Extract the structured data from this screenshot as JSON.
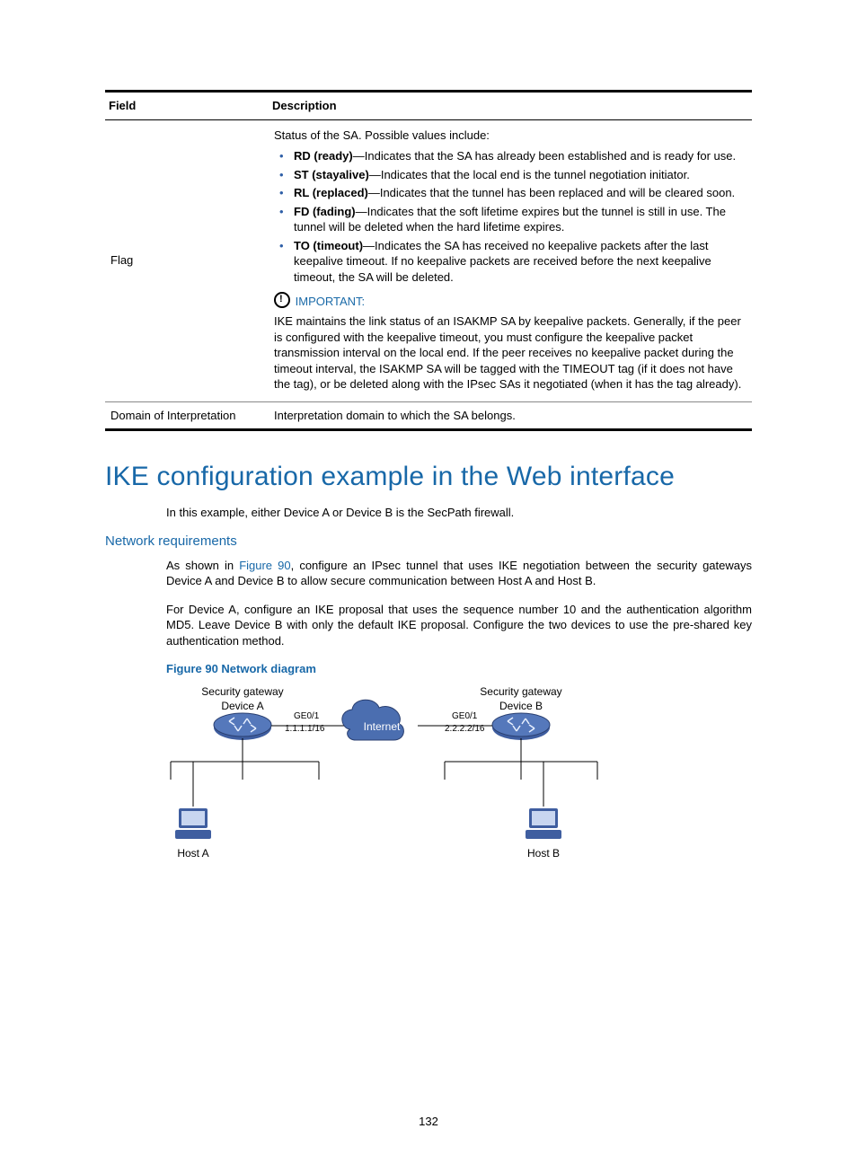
{
  "table": {
    "header_field": "Field",
    "header_desc": "Description",
    "rows": [
      {
        "field": "Flag",
        "intro": "Status of the SA. Possible values include:",
        "items": [
          {
            "strong": "RD (ready)",
            "text": "—Indicates that the SA has already been established and is ready for use."
          },
          {
            "strong": "ST (stayalive)",
            "text": "—Indicates that the local end is the tunnel negotiation initiator."
          },
          {
            "strong": "RL (replaced)",
            "text": "—Indicates that the tunnel has been replaced and will be cleared soon."
          },
          {
            "strong": "FD (fading)",
            "text": "—Indicates that the soft lifetime expires but the tunnel is still in use. The tunnel will be deleted when the hard lifetime expires."
          },
          {
            "strong": "TO (timeout)",
            "text": "—Indicates the SA has received no keepalive packets after the last keepalive timeout. If no keepalive packets are received before the next keepalive timeout, the SA will be deleted."
          }
        ],
        "important_label": "IMPORTANT:",
        "important_text": "IKE maintains the link status of an ISAKMP SA by keepalive packets. Generally, if the peer is configured with the keepalive timeout, you must configure the keepalive packet transmission interval on the local end. If the peer receives no keepalive packet during the timeout interval, the ISAKMP SA will be tagged with the TIMEOUT tag (if it does not have the tag), or be deleted along with the IPsec SAs it negotiated (when it has the tag already)."
      },
      {
        "field": "Domain of Interpretation",
        "desc": "Interpretation domain to which the SA belongs."
      }
    ]
  },
  "section_title": "IKE configuration example in the Web interface",
  "intro_text": "In this example, either Device A or Device B is the SecPath firewall.",
  "subsection_title": "Network requirements",
  "para1_pre": "As shown in ",
  "para1_link": "Figure 90",
  "para1_post": ", configure an IPsec tunnel that uses IKE negotiation between the security gateways Device A and Device B to allow secure communication between Host A and Host B.",
  "para2": "For Device A, configure an IKE proposal that uses the sequence number 10 and the authentication algorithm MD5. Leave Device B with only the default IKE proposal. Configure the two devices to use the pre-shared key authentication method.",
  "figure_caption": "Figure 90 Network diagram",
  "diagram": {
    "gateway_a_title": "Security gateway",
    "gateway_a_sub": "Device A",
    "gateway_a_if": "GE0/1",
    "gateway_a_ip": "1.1.1.1/16",
    "gateway_b_title": "Security gateway",
    "gateway_b_sub": "Device B",
    "gateway_b_if": "GE0/1",
    "gateway_b_ip": "2.2.2.2/16",
    "internet": "Internet",
    "host_a": "Host A",
    "host_b": "Host B"
  },
  "page_number": "132"
}
